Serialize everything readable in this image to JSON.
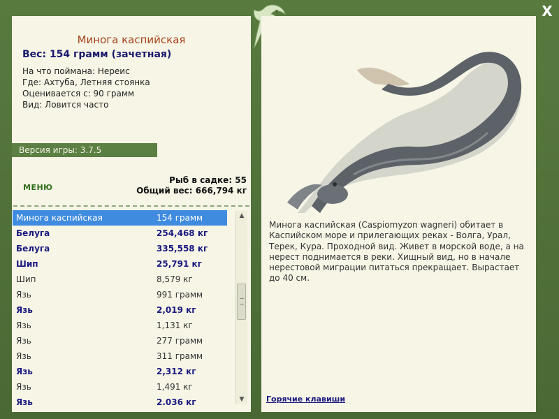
{
  "catch": {
    "name": "Минога каспийская",
    "weight": "Вес: 154 грамм (зачетная)",
    "bait": "На что поймана: Нереис",
    "location": "Где: Ахтуба, Летняя стоянка",
    "value": "Оценивается с: 90 грамм",
    "frequency": "Вид: Ловится часто"
  },
  "version": "Версия игры: 3.7.5",
  "menu_label": "МЕНЮ",
  "keepnet": {
    "count": "Рыб в садке: 55",
    "total": "Общий вес: 666,794 кг"
  },
  "list": [
    {
      "name": "Минога каспийская",
      "weight": "154 грамм",
      "style": "sel"
    },
    {
      "name": "Белуга",
      "weight": "254,468 кг",
      "style": "bold"
    },
    {
      "name": "Белуга",
      "weight": "335,558 кг",
      "style": "bold"
    },
    {
      "name": "Шип",
      "weight": "25,791 кг",
      "style": "bold"
    },
    {
      "name": "Шип",
      "weight": "8,579 кг",
      "style": "plain"
    },
    {
      "name": "Язь",
      "weight": "991 грамм",
      "style": "plain"
    },
    {
      "name": "Язь",
      "weight": "2,019 кг",
      "style": "bold"
    },
    {
      "name": "Язь",
      "weight": "1,131 кг",
      "style": "plain"
    },
    {
      "name": "Язь",
      "weight": "277 грамм",
      "style": "plain"
    },
    {
      "name": "Язь",
      "weight": "311 грамм",
      "style": "plain"
    },
    {
      "name": "Язь",
      "weight": "2,312 кг",
      "style": "bold"
    },
    {
      "name": "Язь",
      "weight": "1,491 кг",
      "style": "plain"
    },
    {
      "name": "Язь",
      "weight": "2.036 кг",
      "style": "bold"
    }
  ],
  "description": "Минога каспийская (Caspiomyzon wagneri) обитает в Каспийском море и прилегающих реках - Волга, Урал, Терек, Кура. Проходной вид. Живет в морской воде, а на нерест поднимается в реки. Хищный вид, но в начале нерестовой миграции питаться прекращает. Вырастает до 40 см.",
  "hotkeys_label": "Горячие клавиши",
  "close_label": "X",
  "colors": {
    "frame": "#4e6d37",
    "panel": "#f6f5e6",
    "selection": "#3f8be0",
    "title": "#a6431b"
  },
  "icons": {
    "logo": "fish-logo-icon",
    "close": "close-icon"
  }
}
